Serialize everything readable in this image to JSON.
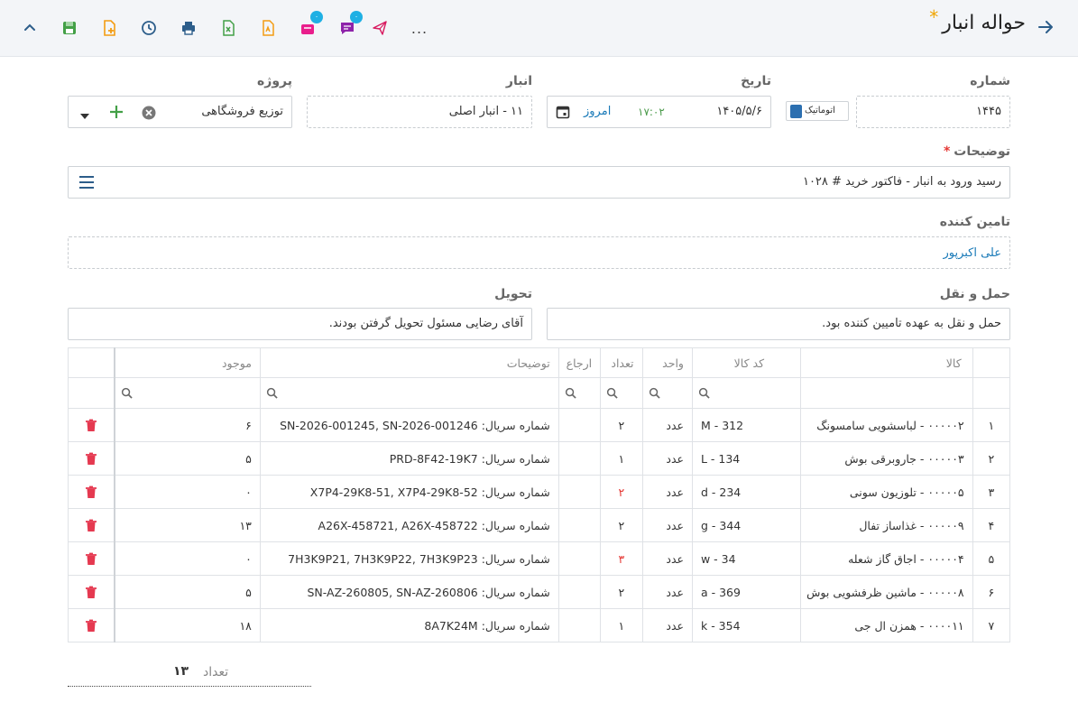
{
  "header": {
    "title": "حواله انبار",
    "required_mark": "*",
    "badge_counts": [
      "۰",
      "۰"
    ],
    "more_label": "..."
  },
  "form": {
    "number": {
      "label": "شماره",
      "value": "۱۴۴۵",
      "auto_label": "اتوماتیک"
    },
    "date": {
      "label": "تاریخ",
      "value": "۱۴۰۵/۵/۶",
      "time": "۱۷:۰۲",
      "today": "امروز"
    },
    "warehouse": {
      "label": "انبار",
      "value": "۱۱ - انبار اصلی"
    },
    "project": {
      "label": "پروژه",
      "value": "توزیع فروشگاهی"
    },
    "description": {
      "label": "توضیحات",
      "required_mark": "*",
      "value": "رسید ورود به انبار - فاکتور خرید # ۱۰۲۸"
    },
    "supplier": {
      "label": "تامین کننده",
      "value": "علی اکبرپور"
    },
    "transport": {
      "label": "حمل و نقل",
      "value": "حمل و نقل به عهده تامیین کننده بود."
    },
    "delivery": {
      "label": "تحویل",
      "value": "آقای رضایی مسئول تحویل گرفتن بودند."
    }
  },
  "table": {
    "headers": [
      "",
      "کالا",
      "کد کالا",
      "واحد",
      "تعداد",
      "ارجاع",
      "توضیحات",
      "موجود",
      ""
    ],
    "rows": [
      {
        "idx": "۱",
        "item": "۰۰۰۰۰۲ - لباسشویی سامسونگ",
        "code": "M - 312",
        "unit": "عدد",
        "qty": "۲",
        "qty_red": false,
        "ref": "",
        "desc": "شماره سریال: SN-2026-001245, SN-2026-001246",
        "stock": "۶"
      },
      {
        "idx": "۲",
        "item": "۰۰۰۰۰۳ - جاروبرقی بوش",
        "code": "L - 134",
        "unit": "عدد",
        "qty": "۱",
        "qty_red": false,
        "ref": "",
        "desc": "شماره سریال: PRD-8F42-19K7",
        "stock": "۵"
      },
      {
        "idx": "۳",
        "item": "۰۰۰۰۰۵ - تلوزیون سونی",
        "code": "d - 234",
        "unit": "عدد",
        "qty": "۲",
        "qty_red": true,
        "ref": "",
        "desc": "شماره سریال: X7P4-29K8-51, X7P4-29K8-52",
        "stock": "۰"
      },
      {
        "idx": "۴",
        "item": "۰۰۰۰۰۹ - غذاساز تفال",
        "code": "g - 344",
        "unit": "عدد",
        "qty": "۲",
        "qty_red": false,
        "ref": "",
        "desc": "شماره سریال: A26X-458721, A26X-458722",
        "stock": "۱۳"
      },
      {
        "idx": "۵",
        "item": "۰۰۰۰۰۴ - اجاق گاز شعله",
        "code": "w - 34",
        "unit": "عدد",
        "qty": "۳",
        "qty_red": true,
        "ref": "",
        "desc": "شماره سریال: 7H3K9P21, 7H3K9P22, 7H3K9P23",
        "stock": "۰"
      },
      {
        "idx": "۶",
        "item": "۰۰۰۰۰۸ - ماشین ظرفشویی بوش",
        "code": "a - 369",
        "unit": "عدد",
        "qty": "۲",
        "qty_red": false,
        "ref": "",
        "desc": "شماره سریال: SN-AZ-260805, SN-AZ-260806",
        "stock": "۵"
      },
      {
        "idx": "۷",
        "item": "۰۰۰۰۱۱ - همزن ال جی",
        "code": "k - 354",
        "unit": "عدد",
        "qty": "۱",
        "qty_red": false,
        "ref": "",
        "desc": "شماره سریال: 8A7K24M",
        "stock": "۱۸"
      }
    ]
  },
  "summary": {
    "label": "تعداد",
    "value": "۱۳"
  },
  "colors": {
    "accent": "#2c6fb0",
    "required": "#e53935",
    "star": "#f0a400",
    "badge": "#1fb0e4",
    "supplier_link": "#1a7ab8"
  }
}
